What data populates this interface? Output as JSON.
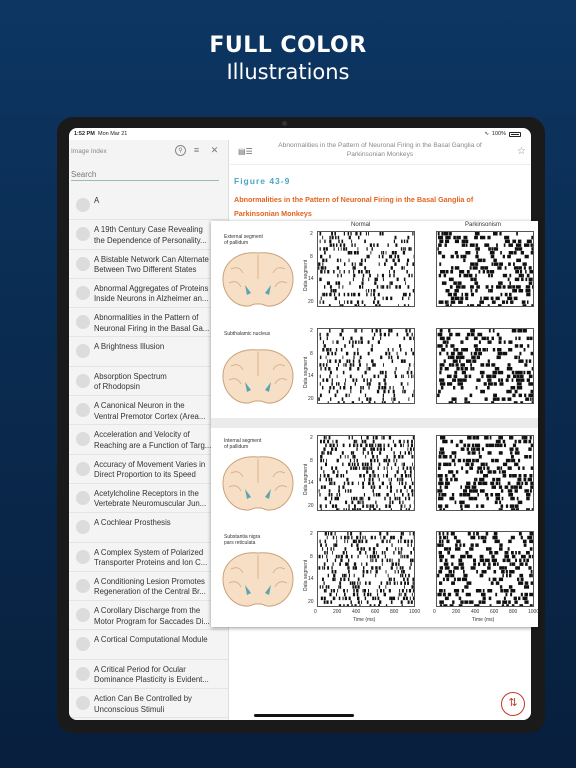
{
  "promo": {
    "title": "FULL COLOR",
    "subtitle": "Illustrations"
  },
  "status": {
    "time": "1:52 PM",
    "date": "Mon Mar 21",
    "battery": "100%"
  },
  "sidebar": {
    "title": "Image Index",
    "search_placeholder": "Search",
    "items": [
      {
        "label": "A"
      },
      {
        "label": "A 19th Century Case Revealing\nthe Dependence of Personality..."
      },
      {
        "label": "A Bistable Network Can Alternate\nBetween Two Different States"
      },
      {
        "label": "Abnormal Aggregates of Proteins\nInside Neurons in Alzheimer an..."
      },
      {
        "label": "Abnormalities in the Pattern of\nNeuronal Firing in the Basal Ga..."
      },
      {
        "label": "A Brightness Illusion"
      },
      {
        "label": "Absorption Spectrum\nof Rhodopsin"
      },
      {
        "label": "A Canonical Neuron in the\nVentral Premotor Cortex (Area..."
      },
      {
        "label": "Acceleration and Velocity of\nReaching are a Function of Targ..."
      },
      {
        "label": "Accuracy of Movement Varies in\nDirect Proportion to its Speed"
      },
      {
        "label": "Acetylcholine Receptors in the\nVertebrate Neuromuscular Jun..."
      },
      {
        "label": "A Cochlear Prosthesis"
      },
      {
        "label": "A Complex System of Polarized\nTransporter Proteins and Ion C..."
      },
      {
        "label": "A Conditioning Lesion Promotes\nRegeneration of the Central Br..."
      },
      {
        "label": "A Corollary Discharge from the\nMotor Program for Saccades Di..."
      },
      {
        "label": "A Cortical Computational Module"
      },
      {
        "label": "A Critical Period for Ocular\nDominance Plasticity is Evident..."
      },
      {
        "label": "Action Can Be Controlled by\nUnconscious Stimuli"
      }
    ]
  },
  "content": {
    "header_title": "Abnormalities in the Pattern of Neuronal Firing in the Basal Ganglia of Parkinsonian Monkeys",
    "figure_label": "Figure 43-9",
    "figure_title": "Abnormalities in the Pattern of Neuronal Firing in the Basal Ganglia of Parkinsonian Monkeys"
  },
  "figure": {
    "col_normal": "Normal",
    "col_parkinsonism": "Parkinsonism",
    "regions": [
      "External segment\nof pallidum",
      "Subthalamic  nucleus",
      "Internal segment\nof pallidum",
      "Substantia nigra\npars reticulata"
    ],
    "y_axis_label": "Data segment",
    "y_ticks": [
      "2",
      "8",
      "14",
      "20"
    ],
    "x_ticks": [
      "0",
      "200",
      "400",
      "600",
      "800",
      "1000"
    ],
    "x_axis_label": "Time (ms)"
  },
  "colors": {
    "accent_blue": "#4aa6c8",
    "title_orange": "#e3641f",
    "fab_red": "#c0392b"
  },
  "icons": [
    "search-icon",
    "filter-icon",
    "close-icon",
    "sidebar-toggle-icon",
    "star-icon",
    "adjust-icon"
  ]
}
